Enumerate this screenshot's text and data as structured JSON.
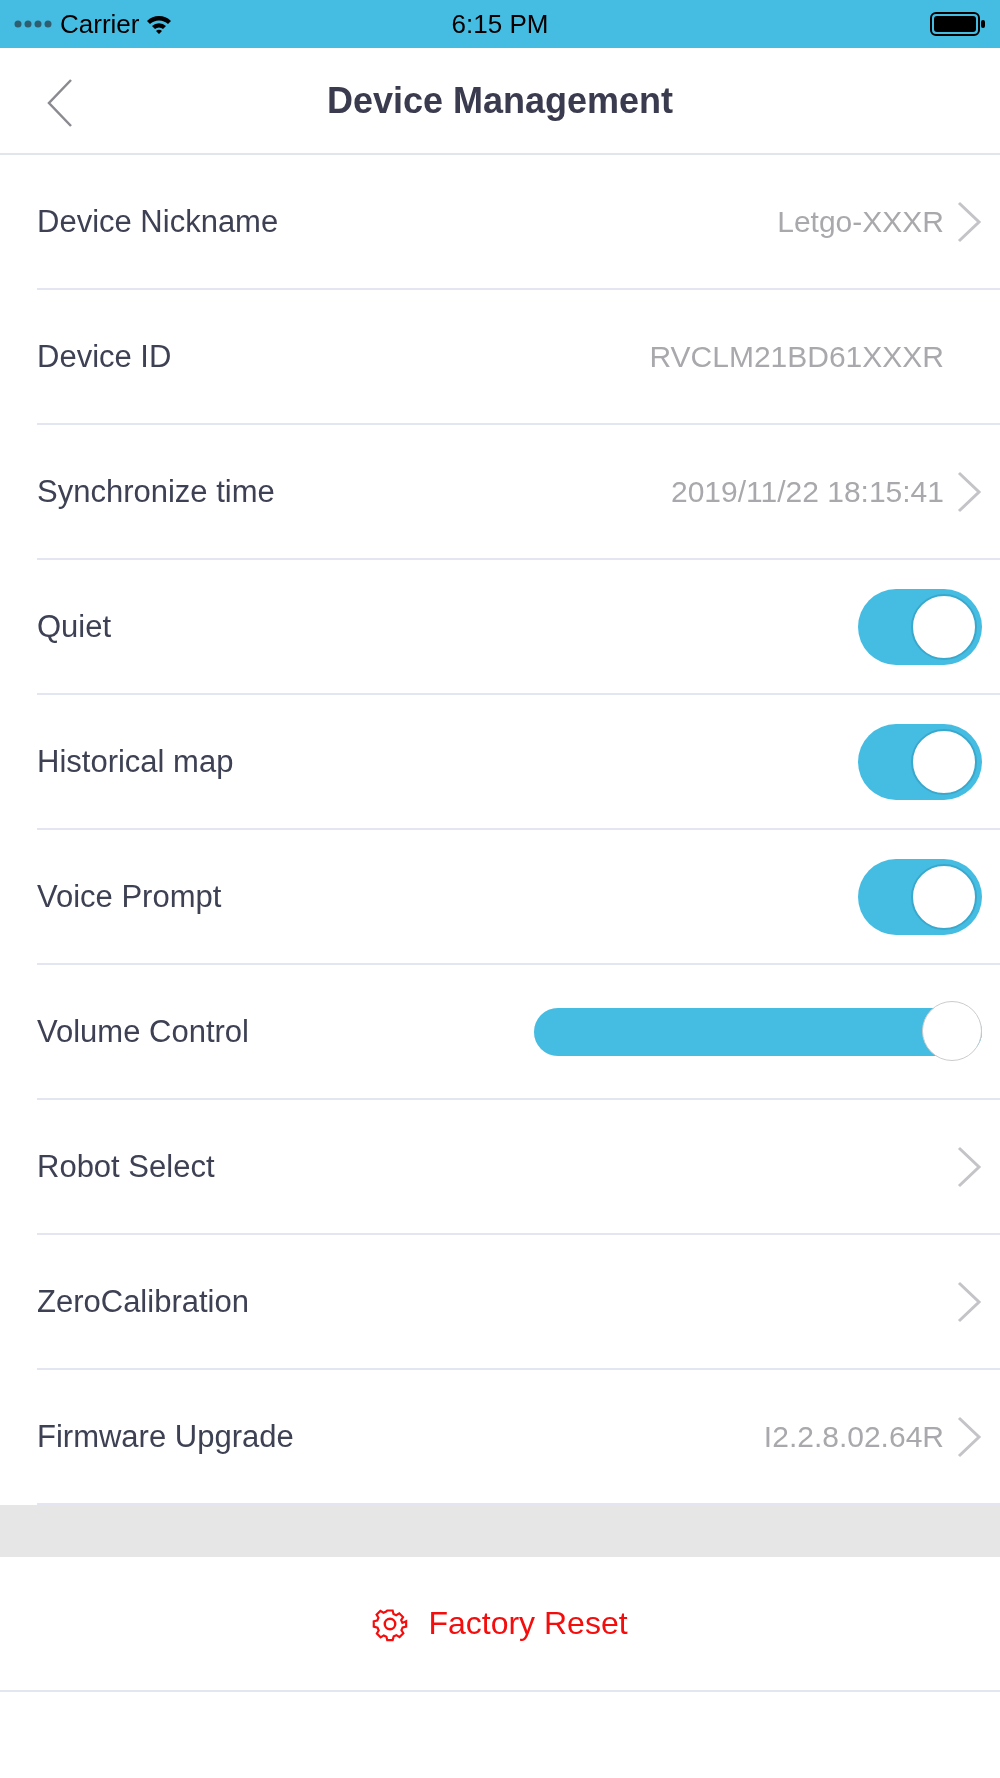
{
  "status_bar": {
    "carrier": "Carrier",
    "time": "6:15 PM"
  },
  "nav": {
    "title": "Device Management"
  },
  "rows": [
    {
      "kind": "link",
      "label": "Device Nickname",
      "value": "Letgo-XXXR"
    },
    {
      "kind": "info",
      "label": "Device ID",
      "value": "RVCLM21BD61XXXR"
    },
    {
      "kind": "link",
      "label": "Synchronize time",
      "value": "2019/11/22 18:15:41"
    },
    {
      "kind": "toggle",
      "label": "Quiet",
      "on": true
    },
    {
      "kind": "toggle",
      "label": "Historical map",
      "on": true
    },
    {
      "kind": "toggle",
      "label": "Voice Prompt",
      "on": true
    },
    {
      "kind": "slider",
      "label": "Volume Control",
      "level": 1
    },
    {
      "kind": "link",
      "label": "Robot Select"
    },
    {
      "kind": "link",
      "label": "ZeroCalibration"
    },
    {
      "kind": "link",
      "label": "Firmware Upgrade",
      "value": "I2.2.8.02.64R"
    }
  ],
  "factory_reset": {
    "label": "Factory Reset"
  }
}
